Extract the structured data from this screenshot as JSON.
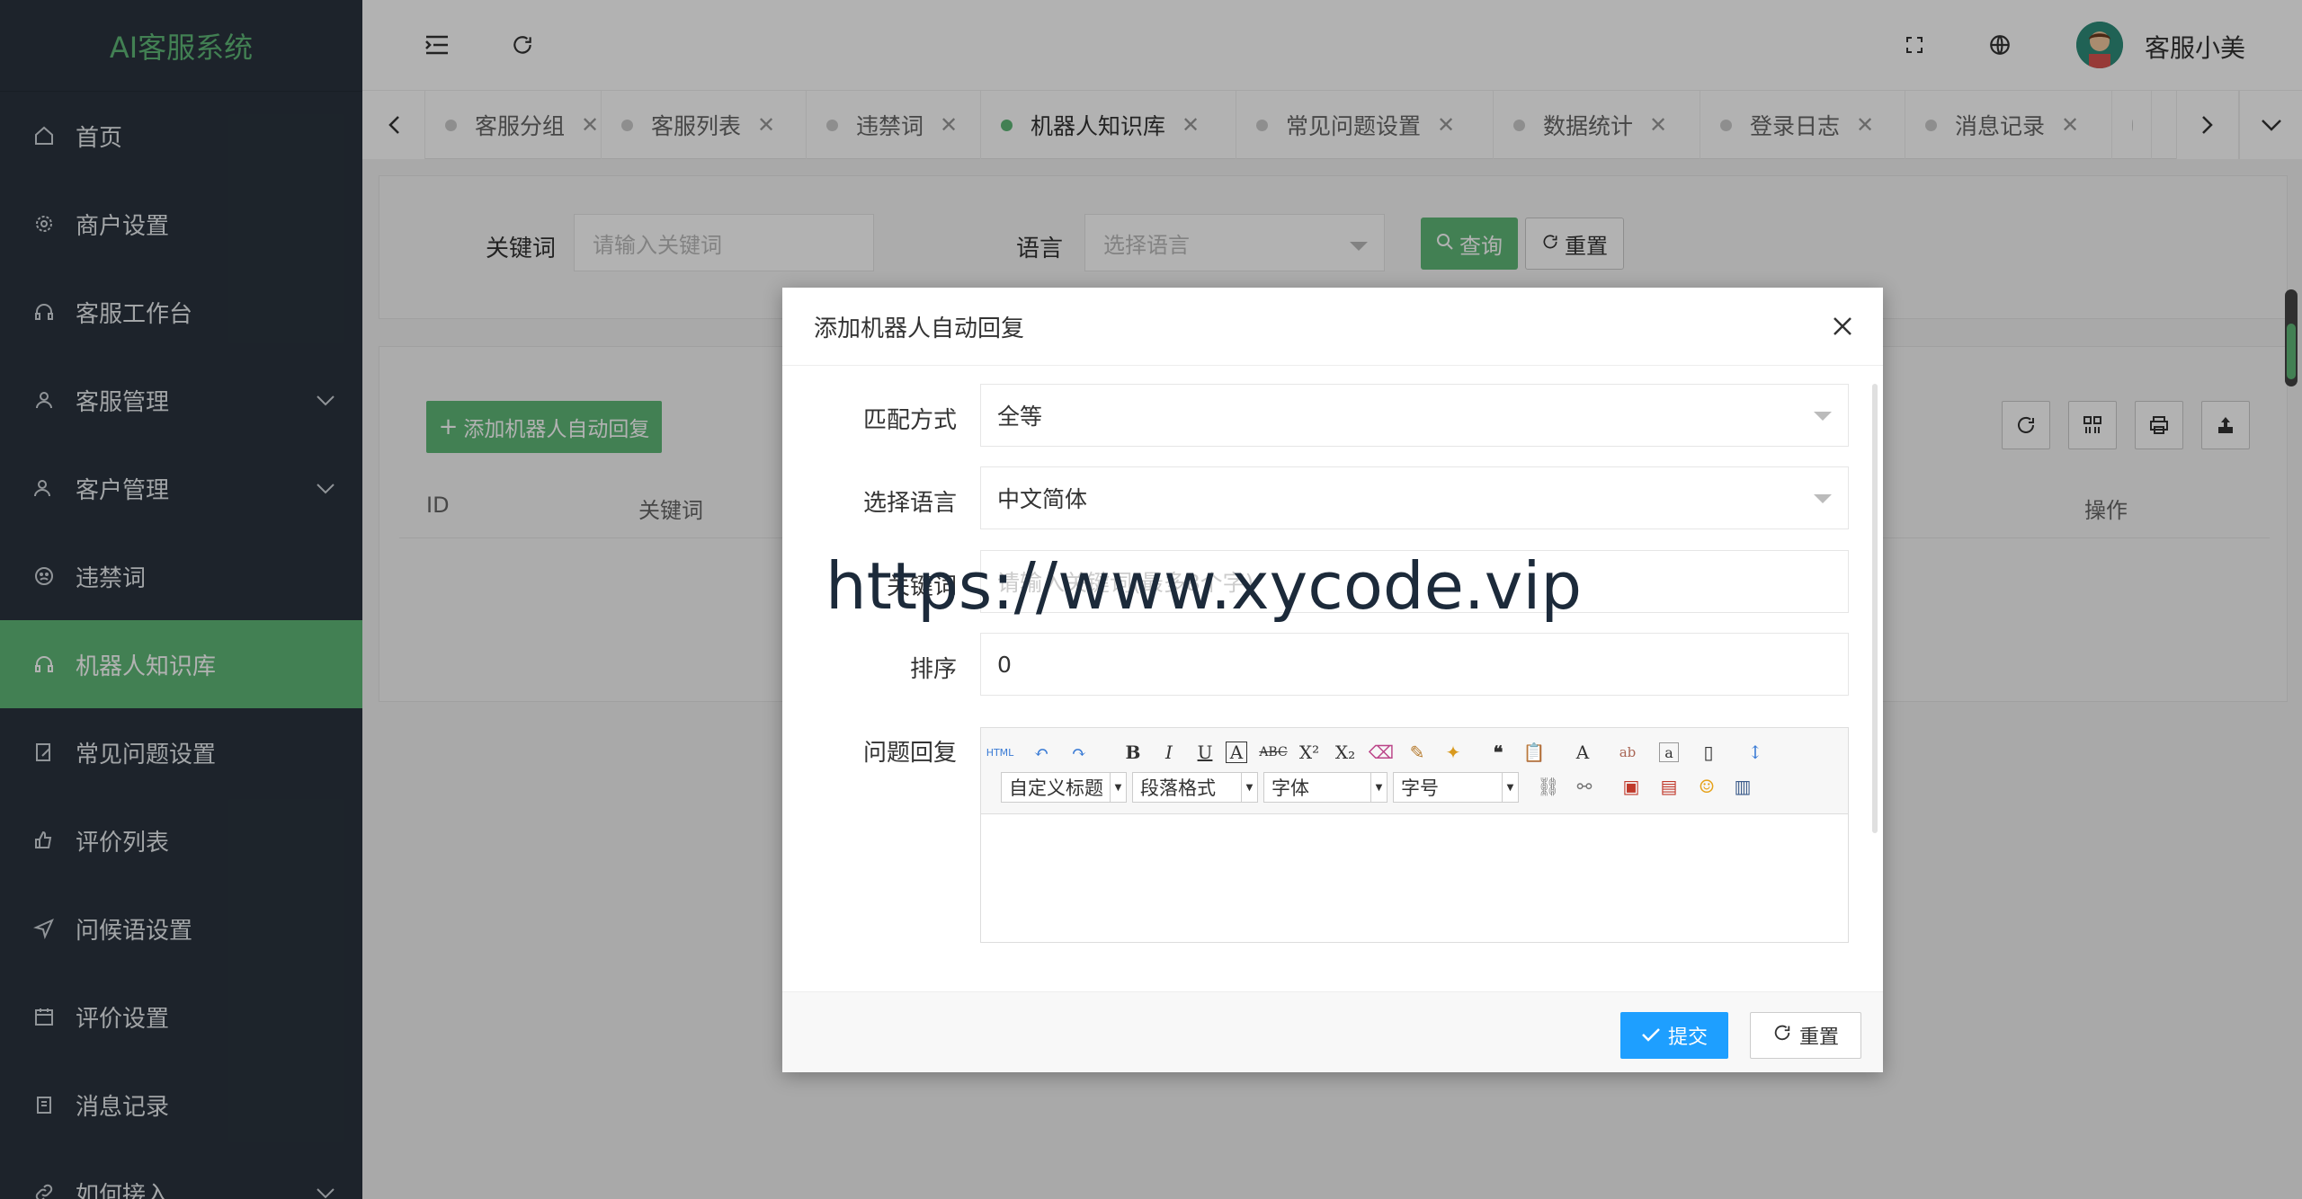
{
  "app": {
    "title": "AI客服系统"
  },
  "sidebar": {
    "items": [
      {
        "label": "首页",
        "icon": "home-icon"
      },
      {
        "label": "商户设置",
        "icon": "gear-icon"
      },
      {
        "label": "客服工作台",
        "icon": "headset-icon"
      },
      {
        "label": "客服管理",
        "icon": "user-icon"
      },
      {
        "label": "客户管理",
        "icon": "users-icon"
      },
      {
        "label": "违禁词",
        "icon": "sad-face-icon"
      },
      {
        "label": "机器人知识库",
        "icon": "headset-icon"
      },
      {
        "label": "常见问题设置",
        "icon": "edit-icon"
      },
      {
        "label": "评价列表",
        "icon": "thumbs-up-icon"
      },
      {
        "label": "问候语设置",
        "icon": "send-icon"
      },
      {
        "label": "评价设置",
        "icon": "calendar-icon"
      },
      {
        "label": "消息记录",
        "icon": "clipboard-icon"
      },
      {
        "label": "如何接入",
        "icon": "link-icon"
      }
    ],
    "active_index": 6
  },
  "header": {
    "user_name": "客服小美"
  },
  "tabs": [
    {
      "label": "客服分组"
    },
    {
      "label": "客服列表"
    },
    {
      "label": "违禁词"
    },
    {
      "label": "机器人知识库",
      "active": true
    },
    {
      "label": "常见问题设置"
    },
    {
      "label": "数据统计"
    },
    {
      "label": "登录日志"
    },
    {
      "label": "消息记录"
    }
  ],
  "search": {
    "keyword_label": "关键词",
    "keyword_placeholder": "请输入关键词",
    "language_label": "语言",
    "language_placeholder": "选择语言",
    "query_button": "查询",
    "reset_button": "重置"
  },
  "table": {
    "add_button": "添加机器人自动回复",
    "columns": [
      "ID",
      "关键词",
      "操作"
    ]
  },
  "modal": {
    "title": "添加机器人自动回复",
    "fields": {
      "match_label": "匹配方式",
      "match_value": "全等",
      "language_label": "选择语言",
      "language_value": "中文简体",
      "keyword_label": "关键词",
      "keyword_placeholder": "请输入关键词(最多8个字)",
      "sort_label": "排序",
      "sort_value": "0",
      "reply_label": "问题回复"
    },
    "editor": {
      "heading_select": "自定义标题",
      "paragraph_select": "段落格式",
      "font_select": "字体",
      "size_select": "字号"
    },
    "submit_button": "提交",
    "reset_button": "重置"
  },
  "watermark": "https://www.xycode.vip",
  "colors": {
    "accent": "#5fb878",
    "sidebar": "#2a333e",
    "primary_blue": "#1e9fff"
  }
}
